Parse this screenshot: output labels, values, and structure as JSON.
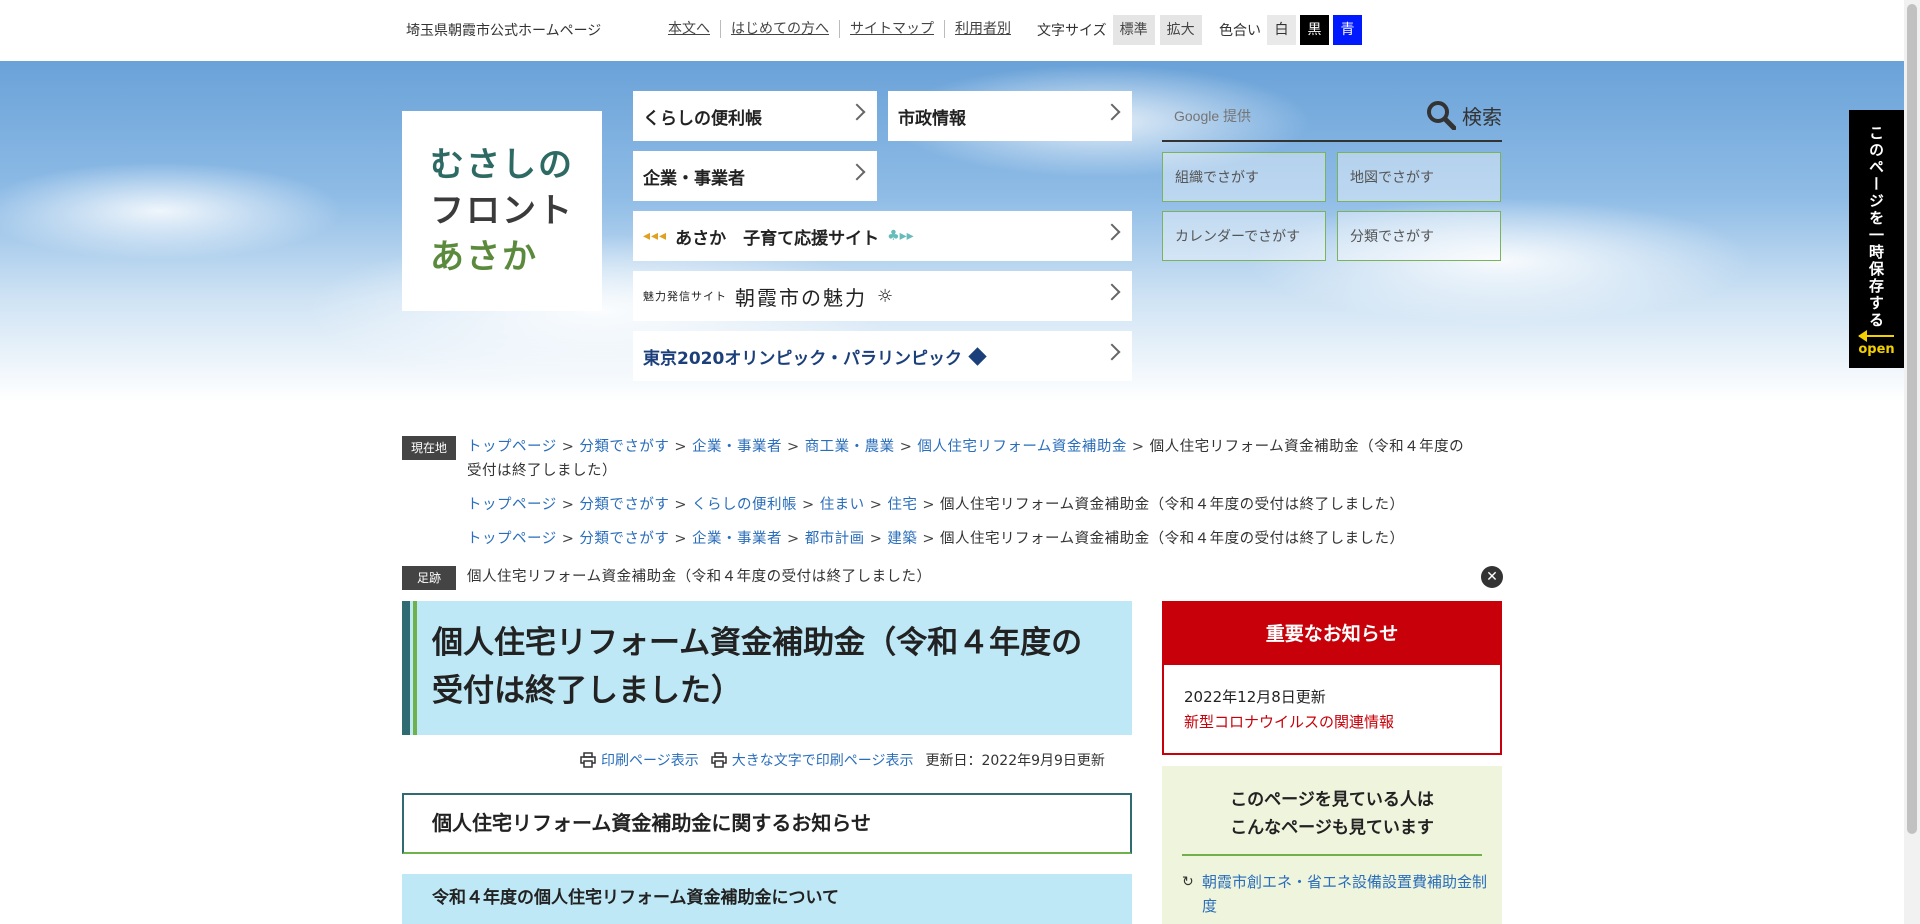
{
  "header": {
    "site_name": "埼玉県朝霞市公式ホームページ",
    "links": [
      "本文へ",
      "はじめての方へ",
      "サイトマップ",
      "利用者別"
    ],
    "font_size_label": "文字サイズ",
    "font_standard": "標準",
    "font_large": "拡大",
    "color_label": "色合い",
    "color_white": "白",
    "color_black": "黒",
    "color_blue": "青"
  },
  "logo": {
    "line1": "むさしの",
    "line2": "フロント",
    "line3": "あさか"
  },
  "nav": {
    "kurashi": "くらしの便利帳",
    "shisei": "市政情報",
    "kigyo": "企業・事業者",
    "kosodate": "あさか　子育て応援サイト",
    "charm_small": "魅力発信サイト",
    "charm": "朝霞市の魅力",
    "olympic": "東京2020オリンピック・パラリンピック"
  },
  "search": {
    "placeholder": "Google 提供",
    "button": "検索",
    "org": "組織でさがす",
    "map": "地図でさがす",
    "calendar": "カレンダーでさがす",
    "category": "分類でさがす"
  },
  "side_tab": {
    "text": "このページを一時保存する",
    "open": "open"
  },
  "breadcrumbs": {
    "current_label": "現在地",
    "history_label": "足跡",
    "trail1": [
      "トップページ",
      "分類でさがす",
      "企業・事業者",
      "商工業・農業",
      "個人住宅リフォーム資金補助金"
    ],
    "trail1_end": "個人住宅リフォーム資金補助金（令和４年度の受付は終了しました）",
    "trail2": [
      "トップページ",
      "分類でさがす",
      "くらしの便利帳",
      "住まい",
      "住宅"
    ],
    "trail2_end": "個人住宅リフォーム資金補助金（令和４年度の受付は終了しました）",
    "trail3": [
      "トップページ",
      "分類でさがす",
      "企業・事業者",
      "都市計画",
      "建築"
    ],
    "trail3_end": "個人住宅リフォーム資金補助金（令和４年度の受付は終了しました）",
    "history_item": "個人住宅リフォーム資金補助金（令和４年度の受付は終了しました）"
  },
  "main": {
    "title": "個人住宅リフォーム資金補助金（令和４年度の受付は終了しました）",
    "print": "印刷ページ表示",
    "print_large": "大きな文字で印刷ページ表示",
    "updated": "更新日：2022年9月9日更新",
    "h2": "個人住宅リフォーム資金補助金に関するお知らせ",
    "h3": "令和４年度の個人住宅リフォーム資金補助金について"
  },
  "notice": {
    "title": "重要なお知らせ",
    "date": "2022年12月8日更新",
    "link": "新型コロナウイルスの関連情報"
  },
  "also_viewed": {
    "title_line1": "このページを見ている人は",
    "title_line2": "こんなページも見ています",
    "link": "朝霞市創エネ・省エネ設備設置費補助金制度"
  }
}
